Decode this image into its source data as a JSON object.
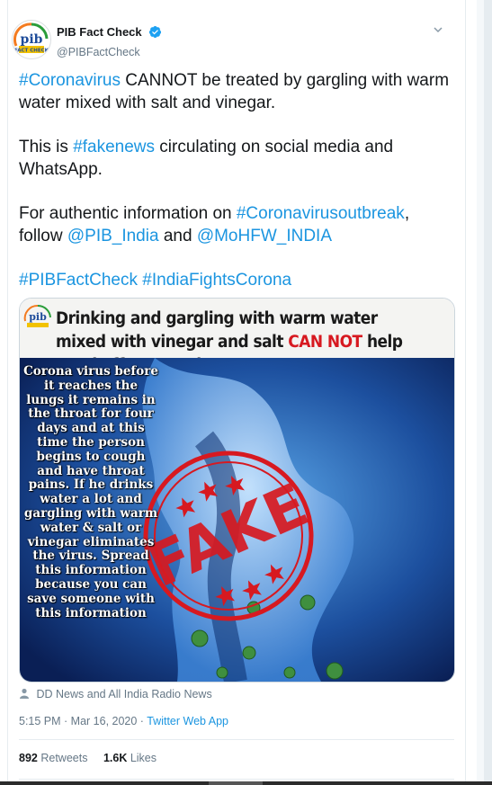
{
  "tweet": {
    "author": {
      "display_name": "PIB Fact Check",
      "handle": "@PIBFactCheck",
      "verified": true
    },
    "line1_hashtag": "#Coronavirus",
    "line1_rest": " CANNOT be treated by gargling with warm water mixed with salt and vinegar.",
    "line2_pre": "This is ",
    "line2_hashtag": "#fakenews",
    "line2_rest": " circulating on social media and WhatsApp.",
    "line3_pre": "For authentic information on ",
    "line3_hashtag": "#Coronavirusoutbreak",
    "line3_mid": ", follow ",
    "mention1": "@PIB_India",
    "line3_and": " and ",
    "mention2": "@MoHFW_INDIA",
    "tag1": "#PIBFactCheck",
    "tag2": "#IndiaFightsCorona",
    "media": {
      "title_pre": "Drinking and gargling with warm water mixed with vinegar and salt ",
      "title_red": "CAN NOT",
      "title_post": " help ward off Coronavirus",
      "body_text": "Corona virus before it reaches the lungs it remains in the throat for four days and at this time the person begins to cough and have throat pains. If he drinks water a lot and gargling with warm water & salt or vinegar eliminates the virus. Spread this information because you can save someone with this information",
      "stamp_text": "FAKE",
      "logo_text": "pib"
    },
    "source": "DD News and All India Radio News",
    "time": "5:15 PM · Mar 16, 2020",
    "separator": " · ",
    "client": "Twitter Web App",
    "retweets_count": "892",
    "retweets_label": "Retweets",
    "likes_count": "1.6K",
    "likes_label": "Likes"
  },
  "colors": {
    "link": "#1b95e0",
    "text": "#14171a",
    "muted": "#657786",
    "stamp": "#d71920"
  }
}
